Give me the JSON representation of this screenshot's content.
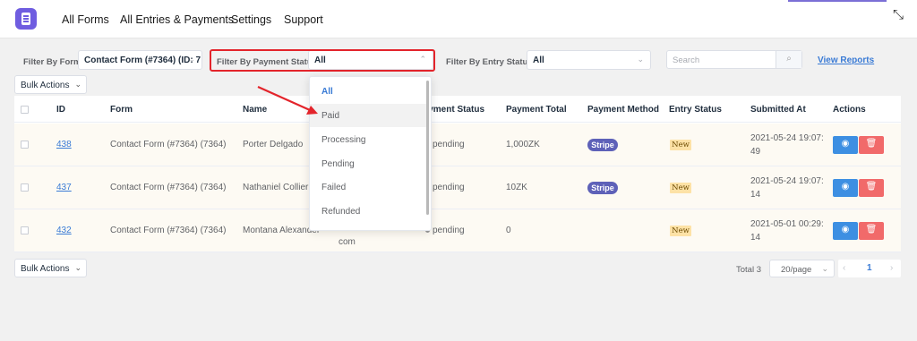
{
  "nav": {
    "items": [
      "All Forms",
      "All Entries & Payments",
      "Settings",
      "Support"
    ]
  },
  "filters": {
    "form_label": "Filter By Form",
    "form_value": "Contact Form (#7364) (ID: 7",
    "payment_label": "Filter By Payment Status",
    "payment_value": "All",
    "entry_label": "Filter By Entry Status",
    "entry_value": "All",
    "search_placeholder": "Search",
    "view_reports": "View Reports"
  },
  "bulk_actions": "Bulk Actions",
  "table": {
    "headers": [
      "ID",
      "Form",
      "Name",
      "Payment Status",
      "Payment Total",
      "Payment Method",
      "Entry Status",
      "Submitted At",
      "Actions"
    ],
    "rows": [
      {
        "id": "438",
        "form": "Contact Form (#7364) (7364)",
        "name": "Porter Delgado",
        "payment_status": "pending",
        "total": "1,000ZK",
        "method": "Stripe",
        "entry_status": "New",
        "submitted_line1": "2021-05-24 19:07:",
        "submitted_line2": "49"
      },
      {
        "id": "437",
        "form": "Contact Form (#7364) (7364)",
        "name": "Nathaniel Collier",
        "payment_status": "pending",
        "total": "10ZK",
        "method": "Stripe",
        "entry_status": "New",
        "submitted_line1": "2021-05-24 19:07:",
        "submitted_line2": "14"
      },
      {
        "id": "432",
        "form": "Contact Form (#7364) (7364)",
        "name": "Montana Alexander",
        "extra": "com",
        "payment_status": "pending",
        "total": "0",
        "method": "",
        "entry_status": "New",
        "submitted_line1": "2021-05-01 00:29:",
        "submitted_line2": "14"
      }
    ]
  },
  "dropdown": {
    "options": [
      "All",
      "Paid",
      "Processing",
      "Pending",
      "Failed",
      "Refunded"
    ],
    "selected": "All",
    "hovered": "Paid"
  },
  "pagination": {
    "total": "Total 3",
    "page_size": "20/page",
    "current_page": "1"
  },
  "colors": {
    "accent": "#3a7bd5",
    "highlight_box": "#e3242b",
    "stripe_badge": "#5e61b8",
    "new_badge": "#fde2a6",
    "view_button": "#3d8fe2",
    "delete_button": "#f16a6a"
  }
}
